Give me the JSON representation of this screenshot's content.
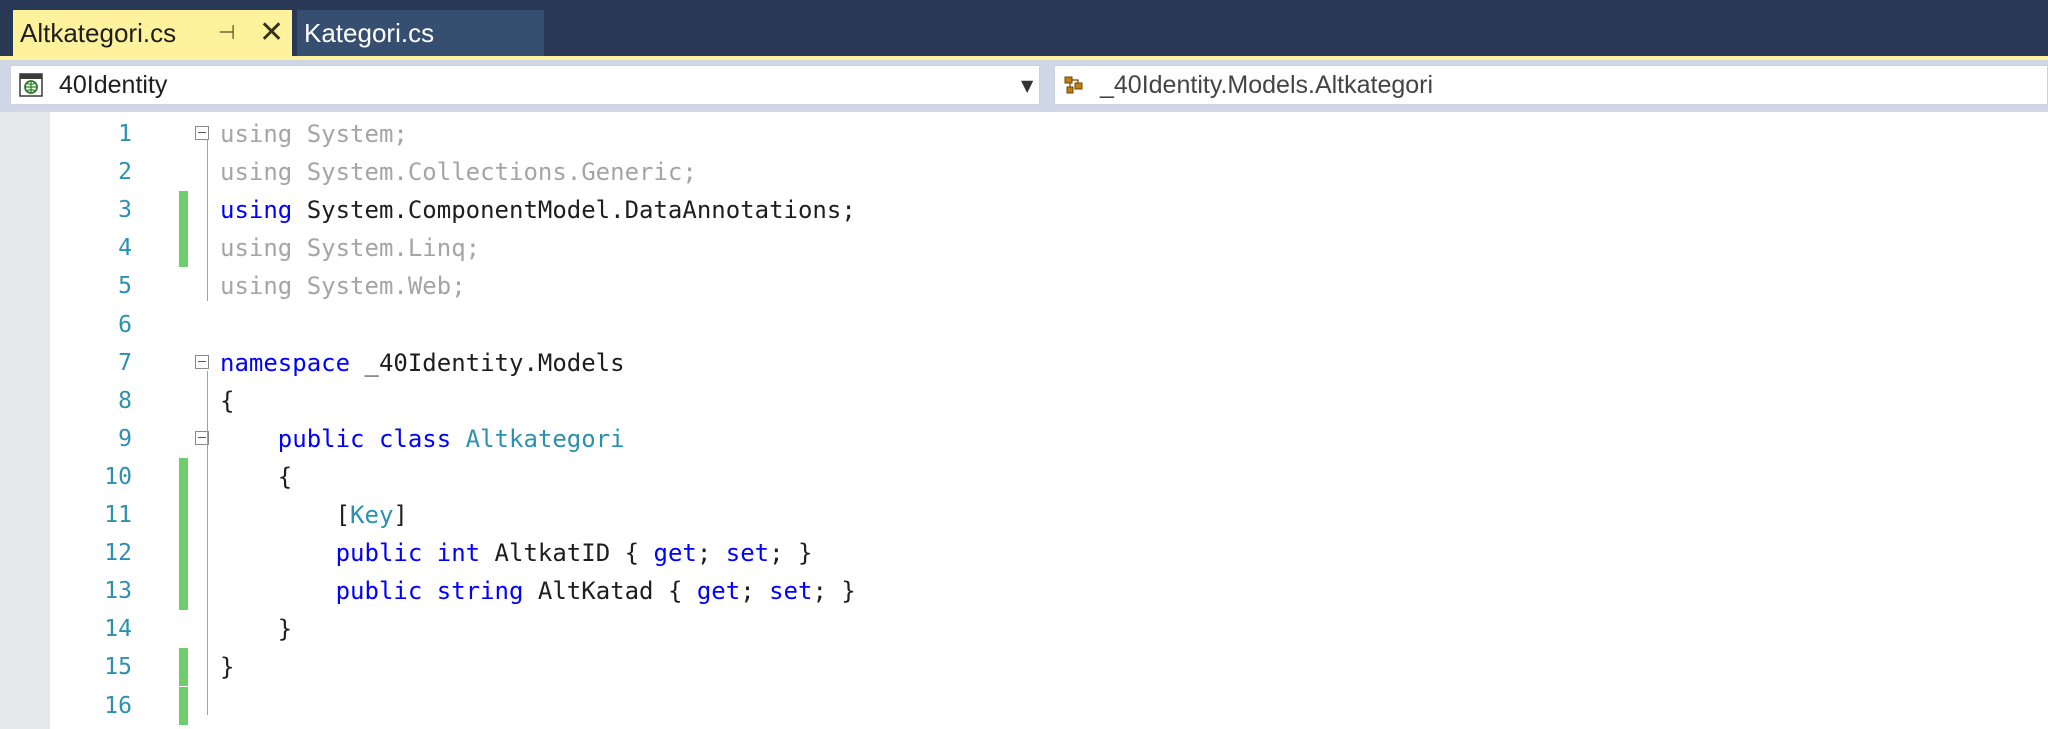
{
  "tabs": [
    {
      "label": "Altkategori.cs",
      "active": true,
      "pinned": true,
      "close_icon": "close-icon"
    },
    {
      "label": "Kategori.cs",
      "active": false
    }
  ],
  "navbar": {
    "project": "40Identity",
    "project_icon": "project-icon",
    "member": "_40Identity.Models.Altkategori",
    "member_icon": "class-icon"
  },
  "colors": {
    "tab_bar": "#293955",
    "active_tab": "#fff29d",
    "inactive_tab": "#364e6f",
    "keyword": "#0000ff",
    "type": "#2b91af",
    "line_number": "#2b91af",
    "unused_using": "#a5a5a5",
    "change_marker": "#6ece6e"
  },
  "code": {
    "lines": [
      {
        "number": "1",
        "tokens": [
          {
            "t": "using",
            "c": "dim"
          },
          {
            "t": " System;",
            "c": "dim"
          }
        ]
      },
      {
        "number": "2",
        "tokens": [
          {
            "t": "using",
            "c": "dim"
          },
          {
            "t": " System.Collections.Generic;",
            "c": "dim"
          }
        ]
      },
      {
        "number": "3",
        "tokens": [
          {
            "t": "using",
            "c": "kw"
          },
          {
            "t": " System.ComponentModel.DataAnnotations;",
            "c": ""
          }
        ]
      },
      {
        "number": "4",
        "tokens": [
          {
            "t": "using",
            "c": "dim"
          },
          {
            "t": " System.Linq;",
            "c": "dim"
          }
        ]
      },
      {
        "number": "5",
        "tokens": [
          {
            "t": "using",
            "c": "dim"
          },
          {
            "t": " System.Web;",
            "c": "dim"
          }
        ]
      },
      {
        "number": "6",
        "tokens": []
      },
      {
        "number": "7",
        "tokens": [
          {
            "t": "namespace",
            "c": "kw"
          },
          {
            "t": " _40Identity.Models",
            "c": ""
          }
        ]
      },
      {
        "number": "8",
        "tokens": [
          {
            "t": "{",
            "c": ""
          }
        ]
      },
      {
        "number": "9",
        "tokens": [
          {
            "t": "    ",
            "c": ""
          },
          {
            "t": "public",
            "c": "kw"
          },
          {
            "t": " ",
            "c": ""
          },
          {
            "t": "class",
            "c": "kw"
          },
          {
            "t": " ",
            "c": ""
          },
          {
            "t": "Altkategori",
            "c": "type"
          }
        ]
      },
      {
        "number": "10",
        "tokens": [
          {
            "t": "    {",
            "c": ""
          }
        ]
      },
      {
        "number": "11",
        "tokens": [
          {
            "t": "        [",
            "c": ""
          },
          {
            "t": "Key",
            "c": "type"
          },
          {
            "t": "]",
            "c": ""
          }
        ]
      },
      {
        "number": "12",
        "tokens": [
          {
            "t": "        ",
            "c": ""
          },
          {
            "t": "public",
            "c": "kw"
          },
          {
            "t": " ",
            "c": ""
          },
          {
            "t": "int",
            "c": "kw"
          },
          {
            "t": " AltkatID { ",
            "c": ""
          },
          {
            "t": "get",
            "c": "kw"
          },
          {
            "t": "; ",
            "c": ""
          },
          {
            "t": "set",
            "c": "kw"
          },
          {
            "t": "; }",
            "c": ""
          }
        ]
      },
      {
        "number": "13",
        "tokens": [
          {
            "t": "        ",
            "c": ""
          },
          {
            "t": "public",
            "c": "kw"
          },
          {
            "t": " ",
            "c": ""
          },
          {
            "t": "string",
            "c": "kw"
          },
          {
            "t": " AltKatad { ",
            "c": ""
          },
          {
            "t": "get",
            "c": "kw"
          },
          {
            "t": "; ",
            "c": ""
          },
          {
            "t": "set",
            "c": "kw"
          },
          {
            "t": "; }",
            "c": ""
          }
        ]
      },
      {
        "number": "14",
        "tokens": [
          {
            "t": "    }",
            "c": ""
          }
        ]
      },
      {
        "number": "15",
        "tokens": [
          {
            "t": "}",
            "c": ""
          }
        ]
      },
      {
        "number": "16",
        "tokens": []
      }
    ]
  }
}
